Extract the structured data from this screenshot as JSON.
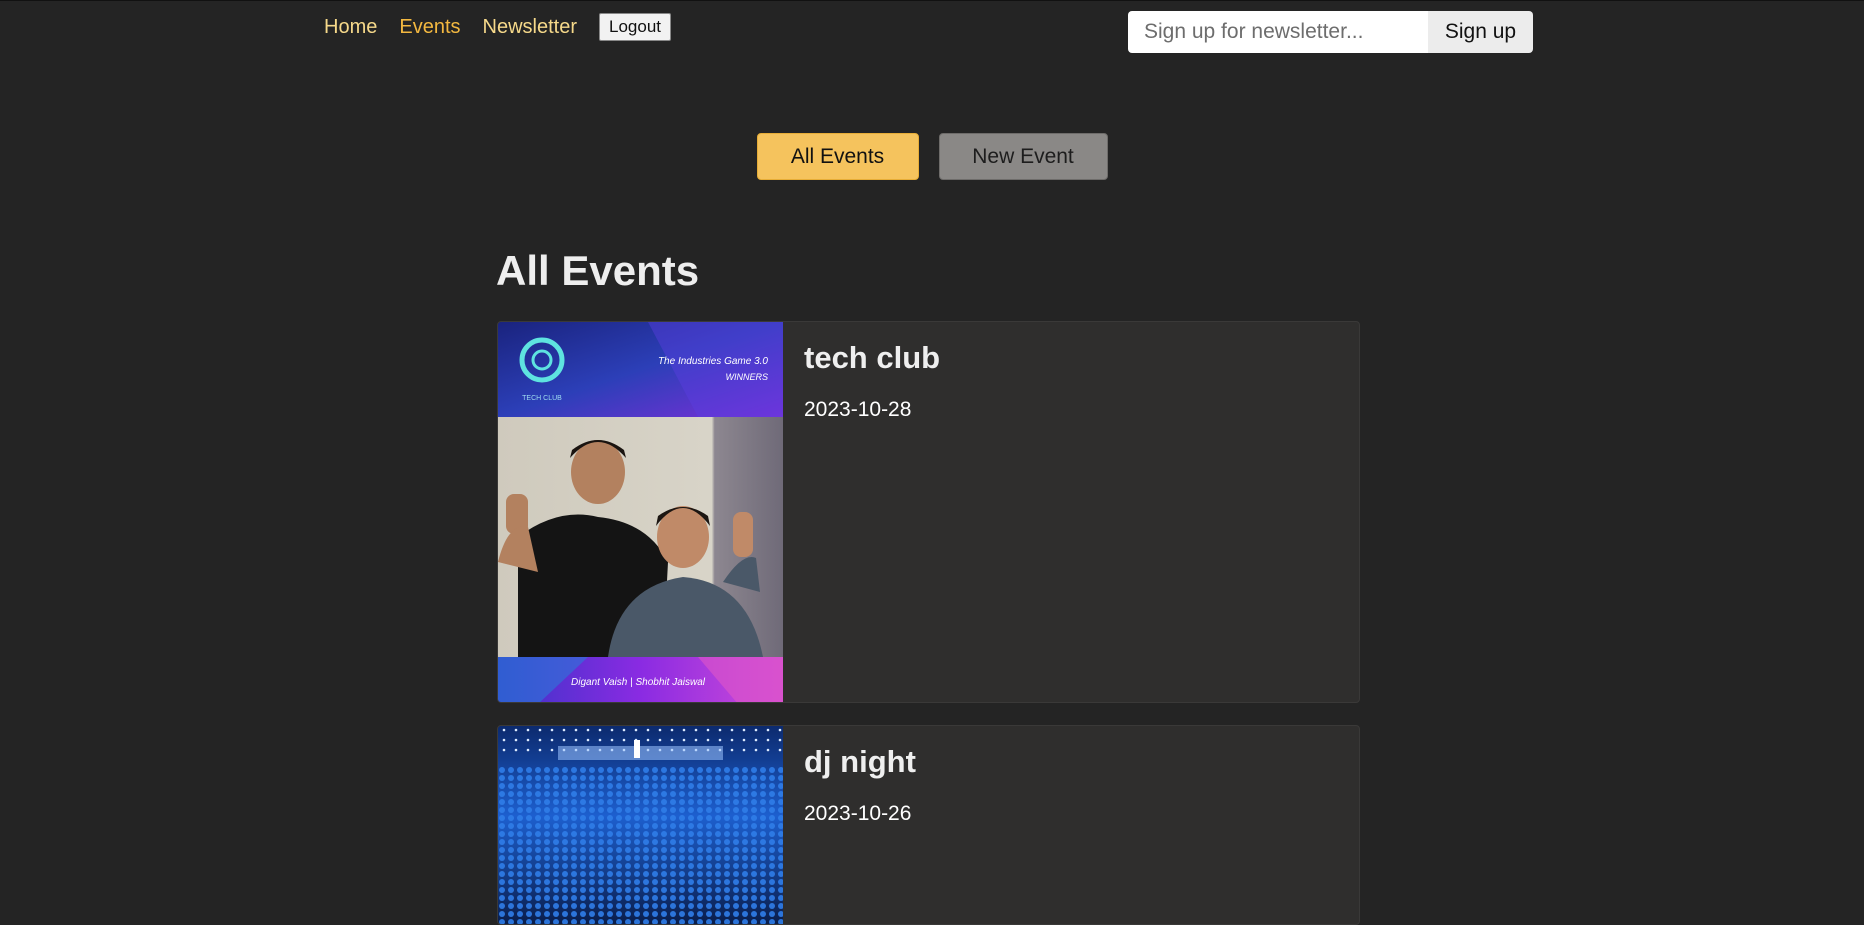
{
  "nav": {
    "home": "Home",
    "events": "Events",
    "newsletter": "Newsletter",
    "logout": "Logout"
  },
  "newsletter_form": {
    "placeholder": "Sign up for newsletter...",
    "button": "Sign up"
  },
  "actions": {
    "all_events": "All Events",
    "new_event": "New Event"
  },
  "page_title": "All Events",
  "events": [
    {
      "title": "tech club",
      "date": "2023-10-28",
      "image_text": {
        "logo": "TECH CLUB",
        "headline": "The Industries Game 3.0",
        "subhead": "WINNERS",
        "names": "Digant Vaish | Shobhit Jaiswal"
      }
    },
    {
      "title": "dj night",
      "date": "2023-10-26"
    }
  ],
  "colors": {
    "background": "#242424",
    "accent": "#f5c35d",
    "nav_active": "#f3b840",
    "card": "#2f2e2d"
  }
}
